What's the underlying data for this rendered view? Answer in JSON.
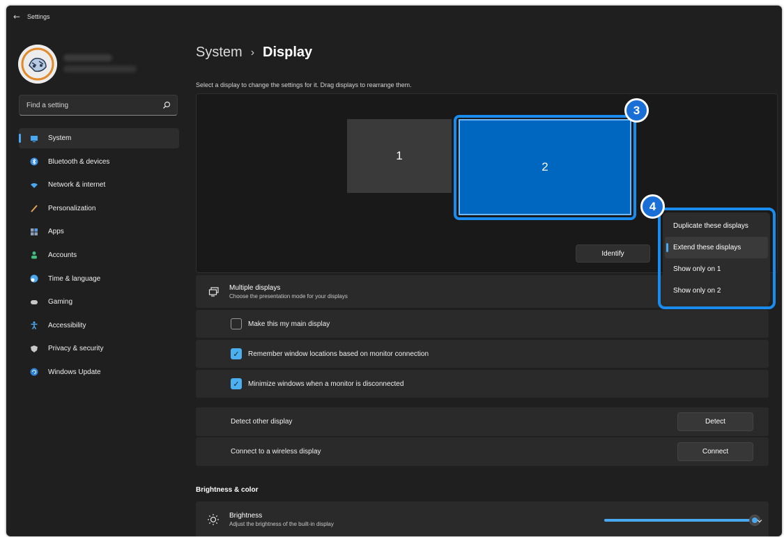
{
  "window": {
    "back_glyph": "←",
    "app_title": "Settings"
  },
  "sidebar": {
    "search_placeholder": "Find a setting",
    "items": [
      {
        "label": "System",
        "icon": "monitor-icon",
        "color": "#4aa8f0",
        "active": true
      },
      {
        "label": "Bluetooth & devices",
        "icon": "bluetooth-icon",
        "color": "#3a8ee6"
      },
      {
        "label": "Network & internet",
        "icon": "wifi-icon",
        "color": "#4aa8f0"
      },
      {
        "label": "Personalization",
        "icon": "brush-icon",
        "color": "#e8a25a"
      },
      {
        "label": "Apps",
        "icon": "apps-icon",
        "color": "#8ea0b8"
      },
      {
        "label": "Accounts",
        "icon": "person-icon",
        "color": "#3fbf7f"
      },
      {
        "label": "Time & language",
        "icon": "globe-clock-icon",
        "color": "#4aa8f0"
      },
      {
        "label": "Gaming",
        "icon": "gamepad-icon",
        "color": "#c8c8c8"
      },
      {
        "label": "Accessibility",
        "icon": "accessibility-icon",
        "color": "#4aa8f0"
      },
      {
        "label": "Privacy & security",
        "icon": "shield-icon",
        "color": "#c8c8c8"
      },
      {
        "label": "Windows Update",
        "icon": "update-icon",
        "color": "#2f80d8"
      }
    ]
  },
  "main": {
    "breadcrumb_parent": "System",
    "breadcrumb_sep": "›",
    "breadcrumb_current": "Display",
    "subtitle": "Select a display to change the settings for it. Drag displays to rearrange them.",
    "monitor1_label": "1",
    "monitor2_label": "2",
    "badge3": "3",
    "badge4": "4",
    "identify_label": "Identify",
    "multiple_displays": {
      "title": "Multiple displays",
      "desc": "Choose the presentation mode for your displays"
    },
    "options": [
      {
        "label": "Make this my main display",
        "checked": false
      },
      {
        "label": "Remember window locations based on monitor connection",
        "checked": true
      },
      {
        "label": "Minimize windows when a monitor is disconnected",
        "checked": true
      }
    ],
    "checkmark_glyph": "✓",
    "detect": {
      "label": "Detect other display",
      "button": "Detect"
    },
    "connect": {
      "label": "Connect to a wireless display",
      "button": "Connect"
    },
    "brightness_section": "Brightness & color",
    "brightness": {
      "title": "Brightness",
      "desc": "Adjust the brightness of the built-in display",
      "level": 0.98
    }
  },
  "flyout": {
    "items": [
      {
        "label": "Duplicate these displays",
        "selected": false
      },
      {
        "label": "Extend these displays",
        "selected": true
      },
      {
        "label": "Show only on 1",
        "selected": false
      },
      {
        "label": "Show only on 2",
        "selected": false
      }
    ]
  },
  "colors": {
    "accent": "#4aa8f0",
    "highlight_ring": "#1a8cf0",
    "selected_monitor": "#0067c0"
  }
}
